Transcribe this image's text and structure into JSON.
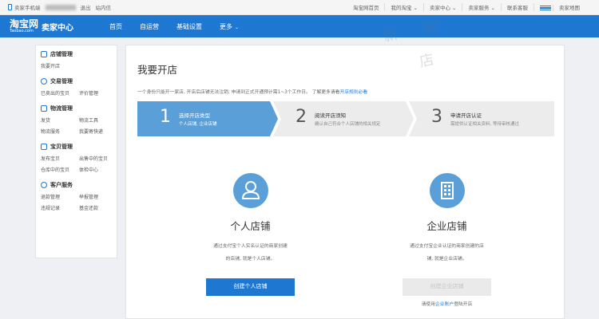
{
  "topbar": {
    "mobile_label": "卖家手机端",
    "logout": "退出",
    "messages": "站内信",
    "links": [
      "淘宝网首页",
      "我的淘宝 ⌄",
      "卖家中心 ⌄",
      "卖家服务 ⌄",
      "联系客服"
    ],
    "sitemap": "卖家地图"
  },
  "header": {
    "logo_cn": "淘宝网",
    "logo_en": "Taobao.com",
    "logo_sub": "卖家中心",
    "nav": [
      "首页",
      "自运营",
      "基础设置"
    ],
    "nav_more": "更多"
  },
  "sidebar": {
    "groups": [
      {
        "title": "店铺管理",
        "links": [
          "我要开店"
        ]
      },
      {
        "title": "交易管理",
        "links": [
          "已卖出的宝贝",
          "评价管理"
        ]
      },
      {
        "title": "物流管理",
        "links": [
          "发货",
          "物流工具",
          "物流服务",
          "我要寄快递"
        ]
      },
      {
        "title": "宝贝管理",
        "links": [
          "发布宝贝",
          "出售中的宝贝",
          "仓库中的宝贝",
          "体检中心"
        ]
      },
      {
        "title": "客户服务",
        "links": [
          "退款管理",
          "举报管理",
          "违规记录",
          "基金还款"
        ]
      }
    ]
  },
  "main": {
    "title": "我要开店",
    "intro": "一个身份只能开一家店, 开店后店铺无法注销; 申请到正式开通预计需1~3个工作日。 了解更多请看",
    "intro_link": "开店规则必看",
    "steps": [
      {
        "num": "1",
        "title": "选择开店类型",
        "desc": "个人店铺, 企业店铺"
      },
      {
        "num": "2",
        "title": "阅读开店须知",
        "desc": "确认自己符合个人店铺的相关规定"
      },
      {
        "num": "3",
        "title": "申请开店认证",
        "desc": "需提供认证相关资料, 等待审核通过"
      }
    ],
    "personal": {
      "title": "个人店铺",
      "desc1": "通过支付宝个人实名认证的商家创建",
      "desc2": "的店铺, 就是个人店铺。",
      "button": "创建个人店铺"
    },
    "enterprise": {
      "title": "企业店铺",
      "desc1": "通过支付宝企业认证的商家创建的店",
      "desc2": "铺, 就是企业店铺。",
      "button": "创建企业店铺",
      "hint_prefix": "请使用",
      "hint_link": "企业账户",
      "hint_suffix": "登陆开店"
    }
  },
  "watermark": [
    "新",
    "网",
    "店"
  ],
  "colors": {
    "brand": "#1e78d2",
    "step_active": "#5b9fd8",
    "step_inactive": "#ececec"
  }
}
